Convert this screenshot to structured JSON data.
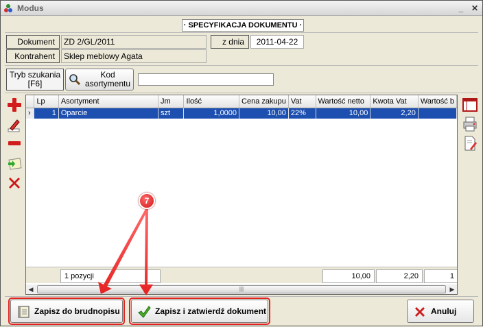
{
  "window": {
    "title": "Modus",
    "min_icon": "minimize-icon",
    "close_icon": "close-icon"
  },
  "section_title": "· SPECYFIKACJA DOKUMENTU ·",
  "document": {
    "doc_label": "Dokument",
    "doc_value": "ZD 2/GL/2011",
    "date_label": "z dnia",
    "date_value": "2011-04-22",
    "contractor_label": "Kontrahent",
    "contractor_value": "Sklep meblowy Agata"
  },
  "search": {
    "mode_line1": "Tryb szukania",
    "mode_line2": "[F6]",
    "button_line1": "Kod",
    "button_line2": "asortymentu",
    "input_value": ""
  },
  "grid": {
    "columns": [
      "",
      "Lp",
      "Asortyment",
      "Jm",
      "Ilość",
      "Cena zakupu",
      "Vat",
      "Wartość netto",
      "Kwota Vat",
      "Wartość b"
    ],
    "rows": [
      {
        "indicator": "›",
        "lp": "1",
        "asortyment": "Oparcie",
        "jm": "szt",
        "ilosc": "1,0000",
        "cena": "10,00",
        "vat": "22%",
        "netto": "10,00",
        "kwota_vat": "2,20",
        "brutto": ""
      }
    ],
    "footer": {
      "count": "1 pozycji",
      "netto_sum": "10,00",
      "vat_sum": "2,20",
      "brutto_sum": "1"
    }
  },
  "buttons": {
    "draft": "Zapisz do brudnopisu",
    "confirm": "Zapisz i zatwierdź dokument",
    "cancel": "Anuluj"
  },
  "annotation": {
    "number": "7"
  },
  "colors": {
    "selection": "#1c4fb0",
    "highlight": "#e52222",
    "badge": "#d01515"
  }
}
